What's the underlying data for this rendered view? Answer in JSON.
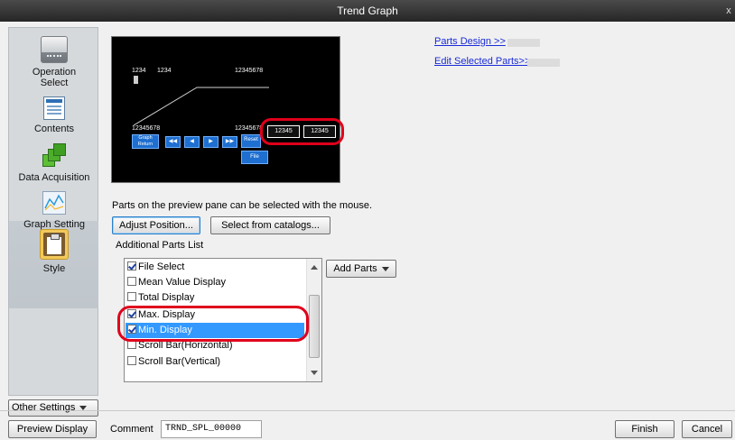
{
  "window": {
    "title": "Trend Graph",
    "close_glyph": "x"
  },
  "sidebar": {
    "items": [
      {
        "label1": "Operation",
        "label2": "Select",
        "icon": "drive-icon"
      },
      {
        "label1": "Contents",
        "icon": "contents-icon"
      },
      {
        "label1": "Data Acquisition",
        "icon": "data-acquisition-icon"
      },
      {
        "label1": "Graph Setting",
        "icon": "graph-icon"
      },
      {
        "label1": "Style",
        "icon": "clipboard-icon"
      }
    ],
    "other_settings": "Other Settings"
  },
  "preview": {
    "texts": [
      "1234",
      "1234",
      "12345678",
      "12345678",
      "12345678"
    ],
    "buttons": [
      "Graph\nReturn",
      "◀◀",
      "◀",
      "▶",
      "▶▶",
      "Reset",
      "File"
    ],
    "boxes": [
      "12345",
      "12345"
    ]
  },
  "links": {
    "parts_design": "Parts Design >>",
    "edit_selected": "Edit Selected Parts>>"
  },
  "hint_text": "Parts on the preview pane can be selected with the mouse.",
  "buttons": {
    "adjust_position": "Adjust Position...",
    "select_catalogs": "Select from catalogs...",
    "add_parts": "Add Parts",
    "preview_display": "Preview Display",
    "finish": "Finish",
    "cancel": "Cancel"
  },
  "additional_parts": {
    "label": "Additional Parts List",
    "items": [
      {
        "label": "File Select",
        "checked": true,
        "selected": false
      },
      {
        "label": "Mean Value Display",
        "checked": false,
        "selected": false
      },
      {
        "label": "Total Display",
        "checked": false,
        "selected": false
      },
      {
        "label": "Max. Display",
        "checked": true,
        "selected": false
      },
      {
        "label": "Min. Display",
        "checked": true,
        "selected": true
      },
      {
        "label": "Scroll Bar(Horizontal)",
        "checked": false,
        "selected": false
      },
      {
        "label": "Scroll Bar(Vertical)",
        "checked": false,
        "selected": false
      }
    ]
  },
  "comment": {
    "label": "Comment",
    "value": "TRND_SPL_00000"
  },
  "colors": {
    "highlight_ring": "#e0001b",
    "selection": "#3399ff",
    "link": "#1a2bd6"
  }
}
